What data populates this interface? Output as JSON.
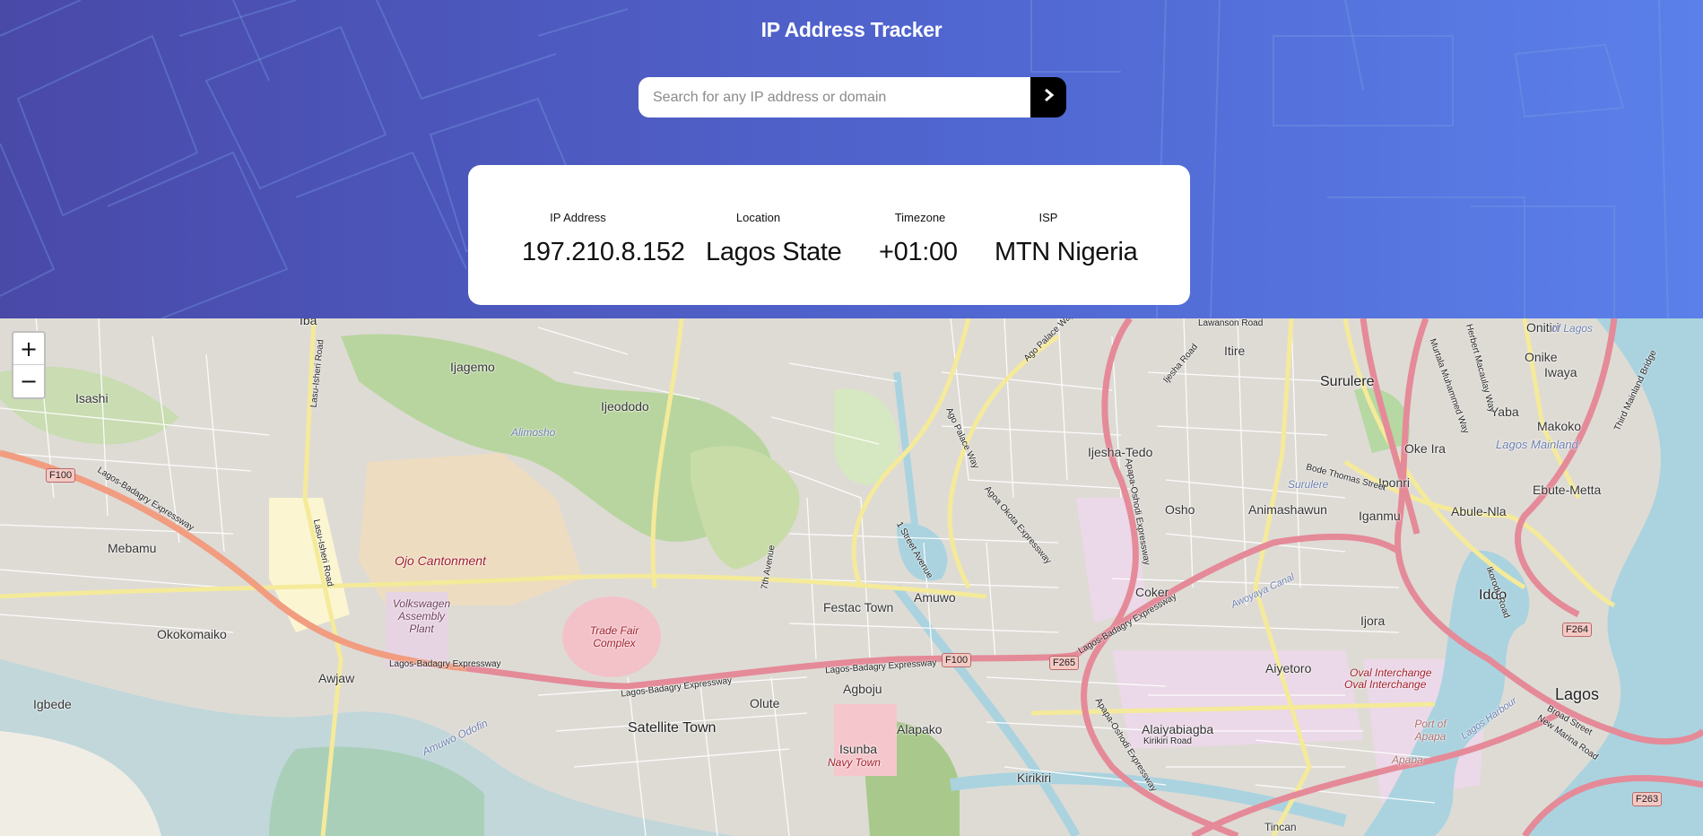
{
  "header": {
    "title": "IP Address Tracker"
  },
  "search": {
    "placeholder": "Search for any IP address or domain",
    "value": "",
    "button_icon": "chevron-right-icon"
  },
  "info": {
    "ip": {
      "label": "IP Address",
      "value": "197.210.8.152"
    },
    "location": {
      "label": "Location",
      "value": "Lagos State"
    },
    "timezone": {
      "label": "Timezone",
      "value": "+01:00"
    },
    "isp": {
      "label": "ISP",
      "value": "MTN Nigeria"
    }
  },
  "map": {
    "zoom_in": "+",
    "zoom_out": "−",
    "places": [
      "Iba",
      "Ijagemo",
      "Isashi",
      "Ijeododo",
      "Alimosho",
      "Itire",
      "Surulere",
      "Onike",
      "Onitiri",
      "of Lagos",
      "Iwaya",
      "Yaba",
      "Makoko",
      "Lagos Mainland",
      "Oke Ira",
      "Ijesha-Tedo",
      "Iponri",
      "Surulere",
      "Osho",
      "Animashawun",
      "Iganmu",
      "Abule-Nla",
      "Ebute-Metta",
      "Mebamu",
      "Ojo Cantonment",
      "Volkswagen Assembly Plant",
      "Trade Fair Complex",
      "Amuwo",
      "Festac Town",
      "Coker",
      "Iddo",
      "Okokomaiko",
      "Ijora",
      "Aiyetoro",
      "Awjaw",
      "Agboju",
      "Oval Interchange",
      "Oval Interchange",
      "Lagos",
      "Igbede",
      "Satellite Town",
      "Olute",
      "Alapako",
      "Alaiyabiagba",
      "Port of Apapa",
      "Apapa",
      "Isunba",
      "Navy Town",
      "Amuwo Odofin",
      "Kirikiri",
      "Tincan",
      "Lagos Harbour"
    ],
    "roads": [
      "Lagos-Badagry Expressway",
      "Lagos-Badagry Expressway",
      "Lagos-Badagry Expressway",
      "Lagos-Badagry Expressway",
      "Lagos-Badagry Expressway",
      "Lasu-Isheri Road",
      "Lasu-Isheri Road",
      "Apapa-Oshodi Expressway",
      "Apapa-Oshodi Expressway",
      "Ago Palace Way",
      "Ago Palace Way",
      "Agoa Okota Expressway",
      "Bode Thomas Street",
      "Kirikiri Road",
      "Broad Street",
      "New Marina Road",
      "7th Avenue",
      "1 Street Avenue",
      "Awoyaya Canal",
      "Ikorodu Road",
      "Third Mainland Bridge",
      "Herbert Macaulay Way",
      "Murtala Muhammed Way",
      "Lawanson Road",
      "Ijesha Road"
    ],
    "shields": [
      "F100",
      "F100",
      "F265",
      "F264",
      "F263"
    ]
  }
}
